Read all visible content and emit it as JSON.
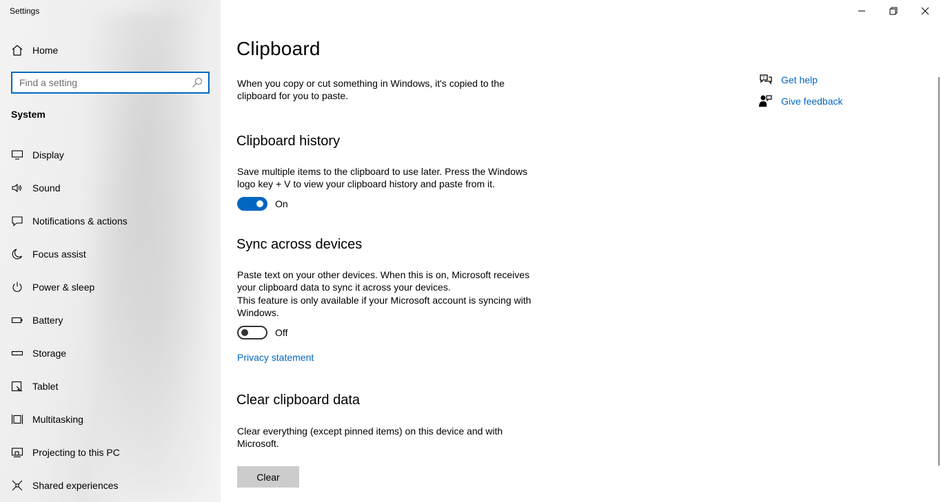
{
  "window": {
    "title": "Settings"
  },
  "sidebar": {
    "home_label": "Home",
    "search_placeholder": "Find a setting",
    "section_label": "System",
    "items": [
      {
        "label": "Display",
        "icon": "display-icon"
      },
      {
        "label": "Sound",
        "icon": "sound-icon"
      },
      {
        "label": "Notifications & actions",
        "icon": "notifications-icon"
      },
      {
        "label": "Focus assist",
        "icon": "moon-icon"
      },
      {
        "label": "Power & sleep",
        "icon": "power-icon"
      },
      {
        "label": "Battery",
        "icon": "battery-icon"
      },
      {
        "label": "Storage",
        "icon": "storage-icon"
      },
      {
        "label": "Tablet",
        "icon": "tablet-icon"
      },
      {
        "label": "Multitasking",
        "icon": "multitasking-icon"
      },
      {
        "label": "Projecting to this PC",
        "icon": "projecting-icon"
      },
      {
        "label": "Shared experiences",
        "icon": "shared-experiences-icon"
      }
    ]
  },
  "main": {
    "title": "Clipboard",
    "intro": "When you copy or cut something in Windows, it's copied to the clipboard for you to paste.",
    "history": {
      "heading": "Clipboard history",
      "description": "Save multiple items to the clipboard to use later. Press the Windows logo key + V to view your clipboard history and paste from it.",
      "toggle_state": "On"
    },
    "sync": {
      "heading": "Sync across devices",
      "description": "Paste text on your other devices. When this is on, Microsoft receives your clipboard data to sync it across your devices.",
      "note": "This feature is only available if your Microsoft account is syncing with Windows.",
      "toggle_state": "Off",
      "privacy_link": "Privacy statement"
    },
    "clear": {
      "heading": "Clear clipboard data",
      "description": "Clear everything (except pinned items) on this device and with Microsoft.",
      "button_label": "Clear"
    }
  },
  "help": {
    "get_help": "Get help",
    "give_feedback": "Give feedback"
  },
  "colors": {
    "accent": "#0067c0",
    "button_gray": "#cccccc"
  }
}
